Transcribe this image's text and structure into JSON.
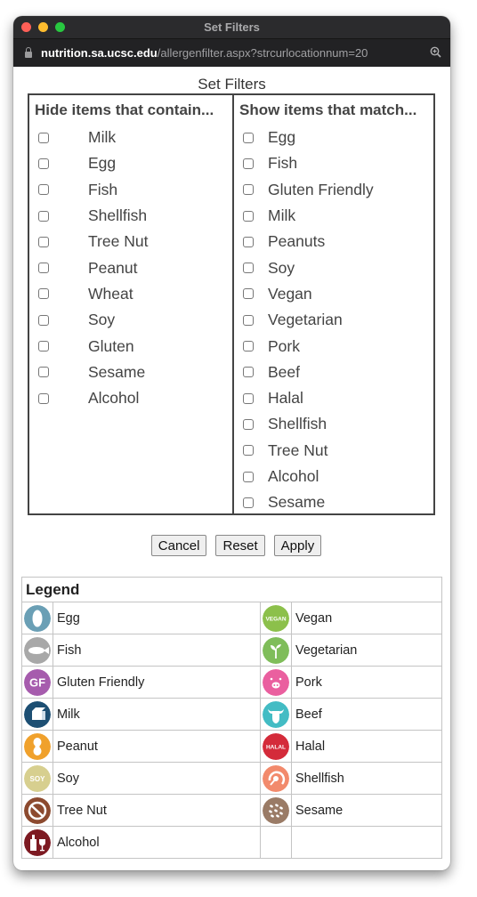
{
  "window": {
    "title": "Set Filters",
    "url_host": "nutrition.sa.ucsc.edu",
    "url_path": "/allergenfilter.aspx?strcurlocationnum=20",
    "traffic_lights": [
      "#ff5f57",
      "#febc2e",
      "#28c840"
    ]
  },
  "page": {
    "title": "Set Filters",
    "hide_column": {
      "header": "Hide items that contain...",
      "items": [
        "Milk",
        "Egg",
        "Fish",
        "Shellfish",
        "Tree Nut",
        "Peanut",
        "Wheat",
        "Soy",
        "Gluten",
        "Sesame",
        "Alcohol"
      ]
    },
    "show_column": {
      "header": "Show items that match...",
      "items": [
        "Egg",
        "Fish",
        "Gluten Friendly",
        "Milk",
        "Peanuts",
        "Soy",
        "Vegan",
        "Vegetarian",
        "Pork",
        "Beef",
        "Halal",
        "Shellfish",
        "Tree Nut",
        "Alcohol",
        "Sesame"
      ]
    },
    "buttons": {
      "cancel": "Cancel",
      "reset": "Reset",
      "apply": "Apply"
    }
  },
  "legend": {
    "title": "Legend",
    "left": [
      {
        "label": "Egg",
        "icon": "egg-icon",
        "color": "#6a9fb5"
      },
      {
        "label": "Fish",
        "icon": "fish-icon",
        "color": "#a8a8a8"
      },
      {
        "label": "Gluten Friendly",
        "icon": "gluten-friendly-icon",
        "color": "#a65cad",
        "text": "GF"
      },
      {
        "label": "Milk",
        "icon": "milk-icon",
        "color": "#1d4f73"
      },
      {
        "label": "Peanut",
        "icon": "peanut-icon",
        "color": "#f0a12c"
      },
      {
        "label": "Soy",
        "icon": "soy-icon",
        "color": "#d7cf8f",
        "text": "SOY"
      },
      {
        "label": "Tree Nut",
        "icon": "tree-nut-icon",
        "color": "#8c4a2f"
      },
      {
        "label": "Alcohol",
        "icon": "alcohol-icon",
        "color": "#7d1a22"
      }
    ],
    "right": [
      {
        "label": "Vegan",
        "icon": "vegan-icon",
        "color": "#8cc04b",
        "text": "VEGAN"
      },
      {
        "label": "Vegetarian",
        "icon": "vegetarian-icon",
        "color": "#7fbd5a"
      },
      {
        "label": "Pork",
        "icon": "pork-icon",
        "color": "#ea5f9f"
      },
      {
        "label": "Beef",
        "icon": "beef-icon",
        "color": "#43bcc4"
      },
      {
        "label": "Halal",
        "icon": "halal-icon",
        "color": "#d42b3a",
        "text": "HALAL"
      },
      {
        "label": "Shellfish",
        "icon": "shellfish-icon",
        "color": "#f28a6c"
      },
      {
        "label": "Sesame",
        "icon": "sesame-icon",
        "color": "#9a7b66"
      }
    ]
  }
}
